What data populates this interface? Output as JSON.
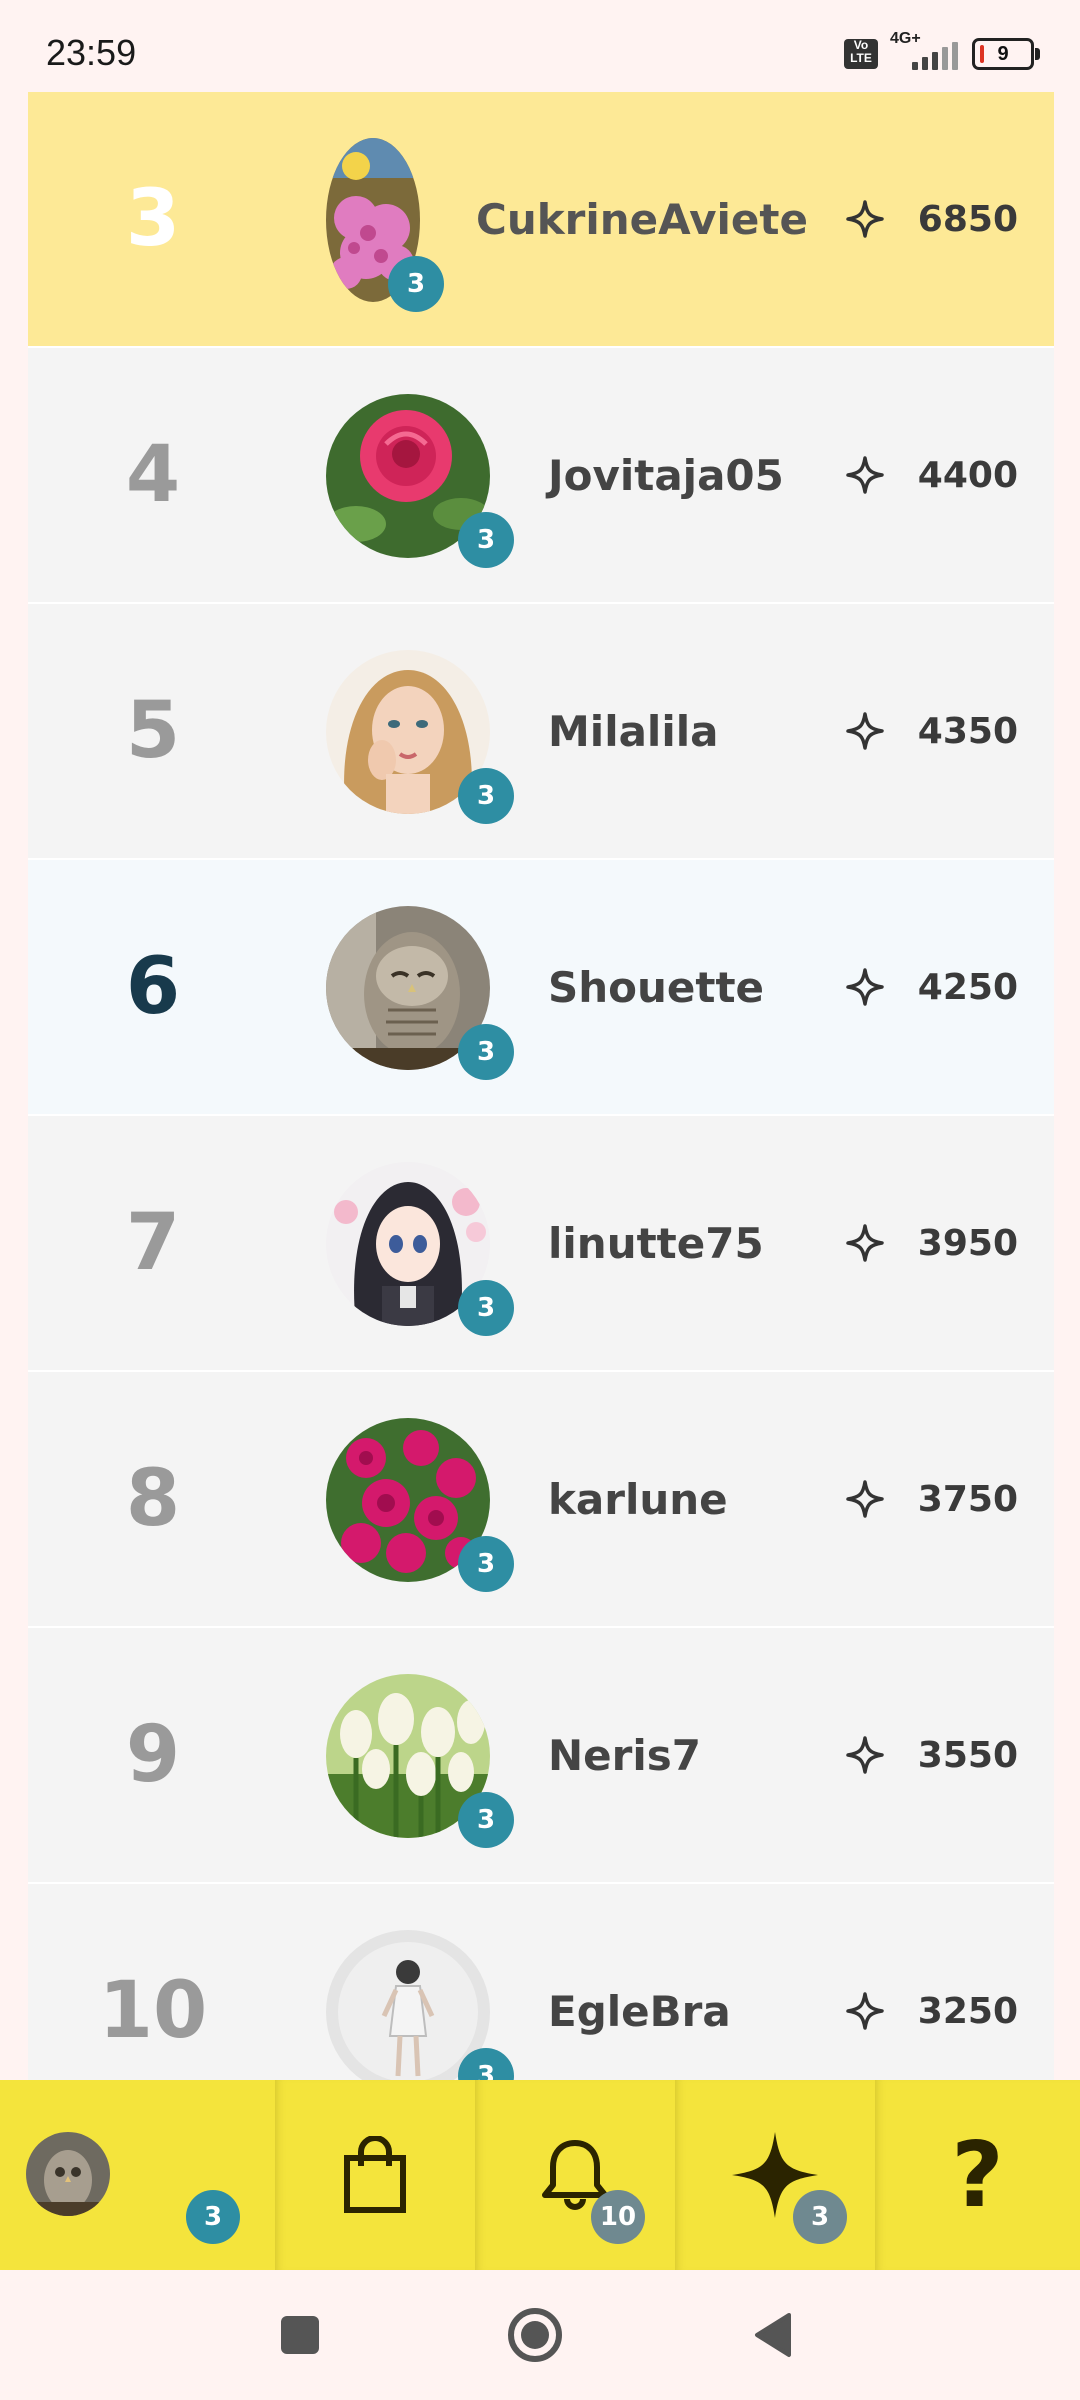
{
  "status": {
    "time": "23:59",
    "volte": "Vo LTE",
    "network": "4G+",
    "battery": "9"
  },
  "leaderboard": [
    {
      "rank": "3",
      "username": "CukrineAviete",
      "level": "3",
      "points": "6850",
      "avatar": "pink-flower-avatar",
      "style": "highlight"
    },
    {
      "rank": "4",
      "username": "Jovitaja05",
      "level": "3",
      "points": "4400",
      "avatar": "red-rose-avatar",
      "style": "normal"
    },
    {
      "rank": "5",
      "username": "Milalila",
      "level": "3",
      "points": "4350",
      "avatar": "illustrated-woman-avatar",
      "style": "normal"
    },
    {
      "rank": "6",
      "username": "Shouette",
      "level": "3",
      "points": "4250",
      "avatar": "owl-avatar",
      "style": "self"
    },
    {
      "rank": "7",
      "username": "linutte75",
      "level": "3",
      "points": "3950",
      "avatar": "anime-girl-avatar",
      "style": "normal"
    },
    {
      "rank": "8",
      "username": "karlune",
      "level": "3",
      "points": "3750",
      "avatar": "magenta-peonies-avatar",
      "style": "normal"
    },
    {
      "rank": "9",
      "username": "Neris7",
      "level": "3",
      "points": "3550",
      "avatar": "white-tulips-avatar",
      "style": "normal"
    },
    {
      "rank": "10",
      "username": "EgleBra",
      "level": "3",
      "points": "3250",
      "avatar": "woman-photo-avatar",
      "style": "normal"
    }
  ],
  "tabbar": {
    "profile_badge": "3",
    "notifications_badge": "10",
    "points_badge": "3",
    "help_label": "?"
  },
  "colors": {
    "highlight_row": "#fde996",
    "tabbar": "#f4e43c",
    "badge_teal": "#2e8ea3"
  }
}
